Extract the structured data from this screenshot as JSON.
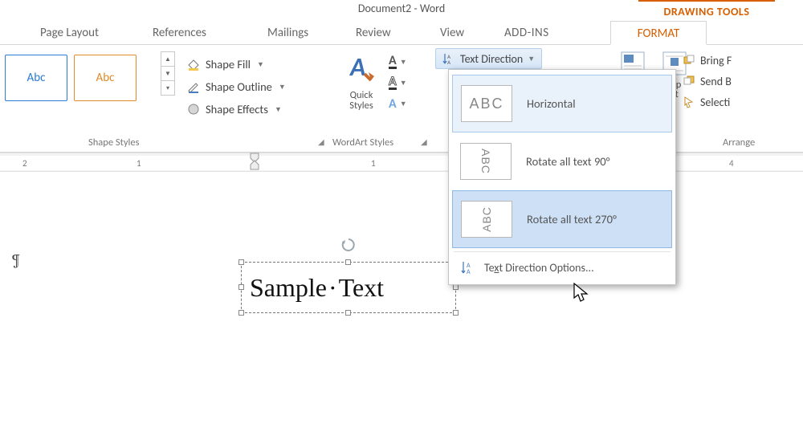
{
  "title": "Document2 - Word",
  "context_tool": "DRAWING TOOLS",
  "tabs": {
    "page_layout": "Page Layout",
    "references": "References",
    "mailings": "Mailings",
    "review": "Review",
    "view": "View",
    "addins": "ADD-INS",
    "format": "FORMAT"
  },
  "groups": {
    "shape_styles": "Shape Styles",
    "wordart_styles": "WordArt Styles",
    "arrange": "Arrange"
  },
  "shape_fill": "Shape Fill",
  "shape_outline": "Shape Outline",
  "shape_effects": "Shape Effects",
  "quick_styles": "Quick\nStyles",
  "text_direction_btn": "Text Direction",
  "wrap_text": "rap\nxt",
  "arrange_items": {
    "bring": "Bring F",
    "send": "Send B",
    "selection": "Selecti"
  },
  "swatch_label": "Abc",
  "ruler": {
    "n2": "2",
    "n1a": "1",
    "n1b": "1",
    "n4": "4"
  },
  "menu": {
    "horizontal": "Horizontal",
    "rotate90": "Rotate all text 90°",
    "rotate270": "Rotate all text 270°",
    "options_pre": "Te",
    "options_u": "x",
    "options_post": "t Direction Options...",
    "thumb_text": "ABC"
  },
  "doc": {
    "sample_a": "Sample",
    "sample_b": "Text",
    "para": "¶"
  },
  "chart_data": null
}
